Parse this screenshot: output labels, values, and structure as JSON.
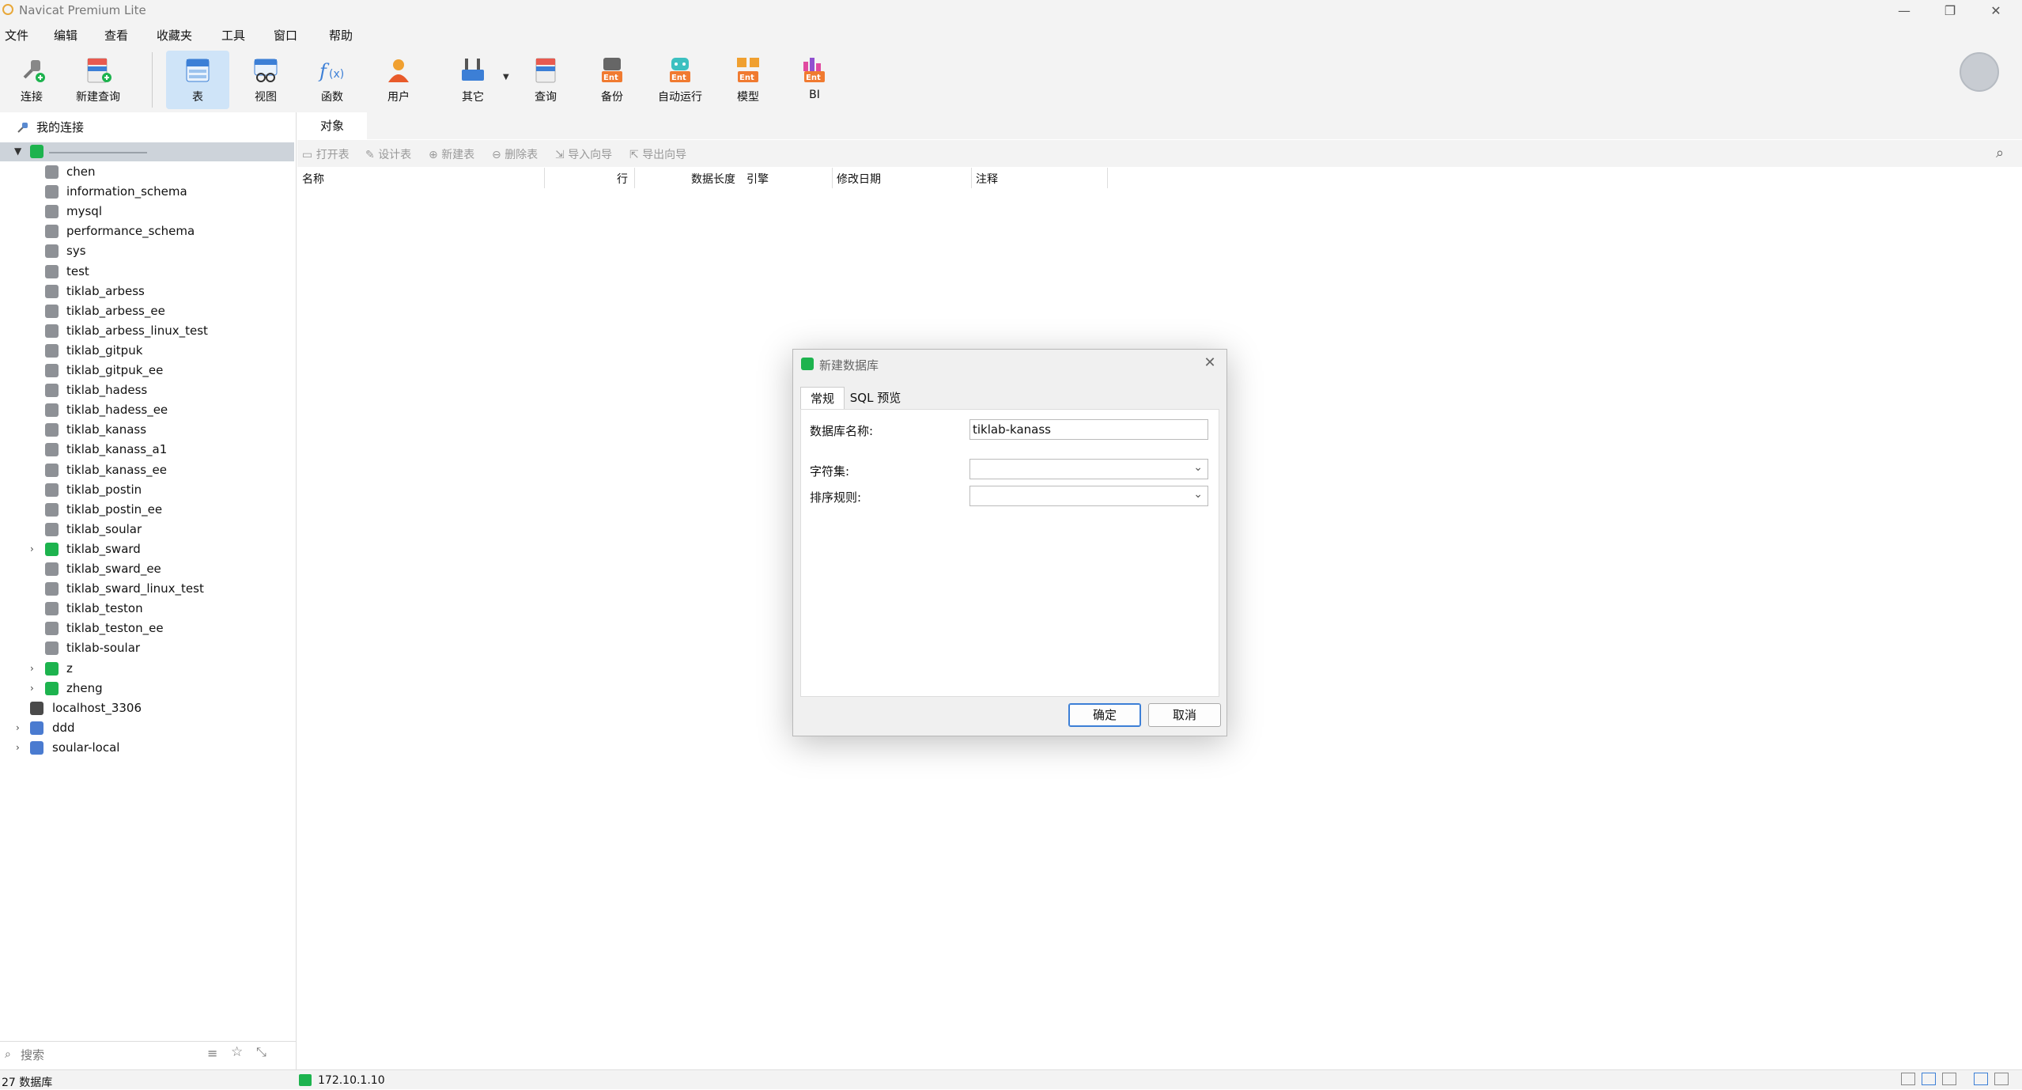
{
  "window": {
    "title": "Navicat Premium Lite",
    "minimize": "—",
    "restore": "❐",
    "close": "✕"
  },
  "menu": [
    "文件",
    "编辑",
    "查看",
    "收藏夹",
    "工具",
    "窗口",
    "帮助"
  ],
  "toolbar": {
    "connect": "连接",
    "new_query": "新建查询",
    "table": "表",
    "view": "视图",
    "function": "函数",
    "user": "用户",
    "other": "其它",
    "query": "查询",
    "backup": "备份",
    "auto_run": "自动运行",
    "model": "模型",
    "bi": "BI",
    "ent_badge": "Ent"
  },
  "sidebar": {
    "header": "我的连接",
    "databases": [
      {
        "name": "chen",
        "green": false,
        "expandable": false
      },
      {
        "name": "information_schema",
        "green": false,
        "expandable": false
      },
      {
        "name": "mysql",
        "green": false,
        "expandable": false
      },
      {
        "name": "performance_schema",
        "green": false,
        "expandable": false
      },
      {
        "name": "sys",
        "green": false,
        "expandable": false
      },
      {
        "name": "test",
        "green": false,
        "expandable": false
      },
      {
        "name": "tiklab_arbess",
        "green": false,
        "expandable": false
      },
      {
        "name": "tiklab_arbess_ee",
        "green": false,
        "expandable": false
      },
      {
        "name": "tiklab_arbess_linux_test",
        "green": false,
        "expandable": false
      },
      {
        "name": "tiklab_gitpuk",
        "green": false,
        "expandable": false
      },
      {
        "name": "tiklab_gitpuk_ee",
        "green": false,
        "expandable": false
      },
      {
        "name": "tiklab_hadess",
        "green": false,
        "expandable": false
      },
      {
        "name": "tiklab_hadess_ee",
        "green": false,
        "expandable": false
      },
      {
        "name": "tiklab_kanass",
        "green": false,
        "expandable": false
      },
      {
        "name": "tiklab_kanass_a1",
        "green": false,
        "expandable": false
      },
      {
        "name": "tiklab_kanass_ee",
        "green": false,
        "expandable": false
      },
      {
        "name": "tiklab_postin",
        "green": false,
        "expandable": false
      },
      {
        "name": "tiklab_postin_ee",
        "green": false,
        "expandable": false
      },
      {
        "name": "tiklab_soular",
        "green": false,
        "expandable": false
      },
      {
        "name": "tiklab_sward",
        "green": true,
        "expandable": true
      },
      {
        "name": "tiklab_sward_ee",
        "green": false,
        "expandable": false
      },
      {
        "name": "tiklab_sward_linux_test",
        "green": false,
        "expandable": false
      },
      {
        "name": "tiklab_teston",
        "green": false,
        "expandable": false
      },
      {
        "name": "tiklab_teston_ee",
        "green": false,
        "expandable": false
      },
      {
        "name": "tiklab-soular",
        "green": false,
        "expandable": false
      },
      {
        "name": "z",
        "green": true,
        "expandable": true
      },
      {
        "name": "zheng",
        "green": true,
        "expandable": true
      }
    ],
    "connections": [
      {
        "name": "localhost_3306",
        "type": "dark",
        "expandable": false
      },
      {
        "name": "ddd",
        "type": "blue",
        "expandable": true
      },
      {
        "name": "soular-local",
        "type": "blue",
        "expandable": true
      }
    ],
    "search_placeholder": "搜索"
  },
  "objects": {
    "tab": "对象",
    "toolbar": [
      "打开表",
      "设计表",
      "新建表",
      "删除表",
      "导入向导",
      "导出向导"
    ],
    "columns": [
      "名称",
      "行",
      "数据长度",
      "引擎",
      "修改日期",
      "注释"
    ]
  },
  "status": {
    "db_count": "27 数据库",
    "connection": "172.10.1.10"
  },
  "dialog": {
    "title": "新建数据库",
    "tabs": [
      "常规",
      "SQL 预览"
    ],
    "db_name_label": "数据库名称:",
    "db_name_value": "tiklab-kanass",
    "charset_label": "字符集:",
    "charset_value": "",
    "collation_label": "排序规则:",
    "collation_value": "",
    "ok": "确定",
    "cancel": "取消"
  },
  "colors": {
    "accent": "#3c7fd6",
    "db_green": "#1db34e",
    "selected_tool": "#cfe4f8"
  }
}
